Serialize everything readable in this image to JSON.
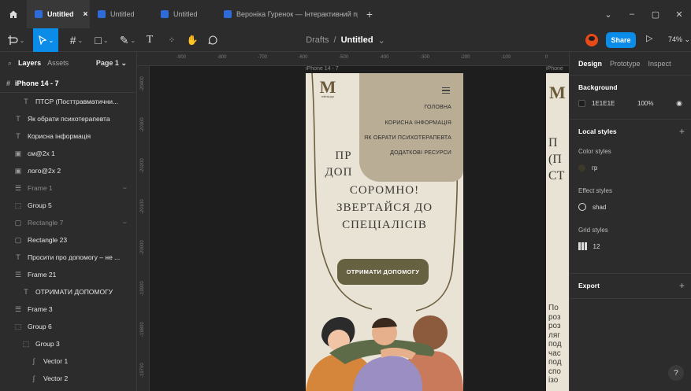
{
  "tabs": [
    {
      "label": "Untitled",
      "active": true
    },
    {
      "label": "Untitled",
      "active": false
    },
    {
      "label": "Untitled",
      "active": false
    },
    {
      "label": "Вероніка Гуренок — Інтерактивний прот",
      "active": false
    }
  ],
  "toolbar": {
    "breadcrumb_root": "Drafts",
    "breadcrumb_sep": "/",
    "file_name": "Untitled",
    "share_label": "Share",
    "zoom": "74%"
  },
  "layers_panel": {
    "tab_layers": "Layers",
    "tab_assets": "Assets",
    "page": "Page 1",
    "frame": "iPhone 14 - 7",
    "items": [
      {
        "label": "ПТСР (Посттравматични...",
        "icon": "T",
        "indent": 3,
        "hidden": false
      },
      {
        "label": "Як обрати психотерапевта",
        "icon": "T",
        "indent": 2,
        "hidden": false
      },
      {
        "label": "Корисна інформація",
        "icon": "T",
        "indent": 2,
        "hidden": false
      },
      {
        "label": "см@2x 1",
        "icon": "img",
        "indent": 2,
        "hidden": false
      },
      {
        "label": "лого@2x 2",
        "icon": "img",
        "indent": 2,
        "hidden": false
      },
      {
        "label": "Frame 1",
        "icon": "frame",
        "indent": 2,
        "hidden": true
      },
      {
        "label": "Group 5",
        "icon": "group",
        "indent": 2,
        "hidden": false
      },
      {
        "label": "Rectangle 7",
        "icon": "rect",
        "indent": 2,
        "hidden": true
      },
      {
        "label": "Rectangle 23",
        "icon": "rect",
        "indent": 2,
        "hidden": false
      },
      {
        "label": "Просити про допомогу – не ...",
        "icon": "T",
        "indent": 2,
        "hidden": false
      },
      {
        "label": "Frame 21",
        "icon": "frame",
        "indent": 2,
        "hidden": false
      },
      {
        "label": "ОТРИМАТИ ДОПОМОГУ",
        "icon": "T",
        "indent": 3,
        "hidden": false
      },
      {
        "label": "Frame 3",
        "icon": "frame",
        "indent": 2,
        "hidden": false
      },
      {
        "label": "Group 6",
        "icon": "group",
        "indent": 2,
        "hidden": false
      },
      {
        "label": "Group 3",
        "icon": "group",
        "indent": 3,
        "hidden": false
      },
      {
        "label": "Vector 1",
        "icon": "vector",
        "indent": 4,
        "hidden": false
      },
      {
        "label": "Vector 2",
        "icon": "vector",
        "indent": 4,
        "hidden": false
      }
    ]
  },
  "ruler": {
    "top": [
      "-900",
      "-800",
      "-700",
      "-600",
      "-500",
      "-400",
      "-300",
      "-200",
      "-100",
      "0"
    ],
    "left": [
      "-20400",
      "-20300",
      "-20200",
      "-20100",
      "-20000",
      "-19900",
      "-19800",
      "-19700"
    ]
  },
  "canvas": {
    "frame_label": "iPhone 14 - 7",
    "frame2_label": "iPhone",
    "logo_letter": "M",
    "logo_text": "mlinsopy",
    "menu": [
      "ГОЛОВНА",
      "КОРИСНА ІНФОРМАЦІЯ",
      "ЯК ОБРАТИ ПСИХОТЕРАПЕВТА",
      "ДОДАТКОВІ РЕСУРСИ"
    ],
    "heading_lines": [
      "ПР",
      "ДОП",
      "СОРОМНО!",
      "ЗВЕРТАЙСЯ ДО",
      "СПЕЦІАЛІСІВ"
    ],
    "cta": "ОТРИМАТИ ДОПОМОГУ",
    "frame2_heading": [
      "П",
      "(П",
      "СТ"
    ],
    "frame2_body": [
      "По",
      "роз",
      "роз",
      "ляг",
      "под",
      "час",
      "под",
      "спо",
      "ізо"
    ]
  },
  "design_panel": {
    "tabs": [
      "Design",
      "Prototype",
      "Inspect"
    ],
    "background_title": "Background",
    "background_hex": "1E1E1E",
    "background_opacity": "100%",
    "local_styles": "Local styles",
    "color_styles": "Color styles",
    "color_style_name": "гр",
    "effect_styles": "Effect styles",
    "effect_style_name": "shad",
    "grid_styles": "Grid styles",
    "grid_style_name": "12",
    "export": "Export"
  },
  "colors": {
    "accent": "#0c8ce9",
    "panel": "#2c2c2c",
    "canvas": "#1e1e1e",
    "phone_bg": "#e9e3d6",
    "menu_bg": "#b9ad95",
    "cta_bg": "#666141"
  }
}
